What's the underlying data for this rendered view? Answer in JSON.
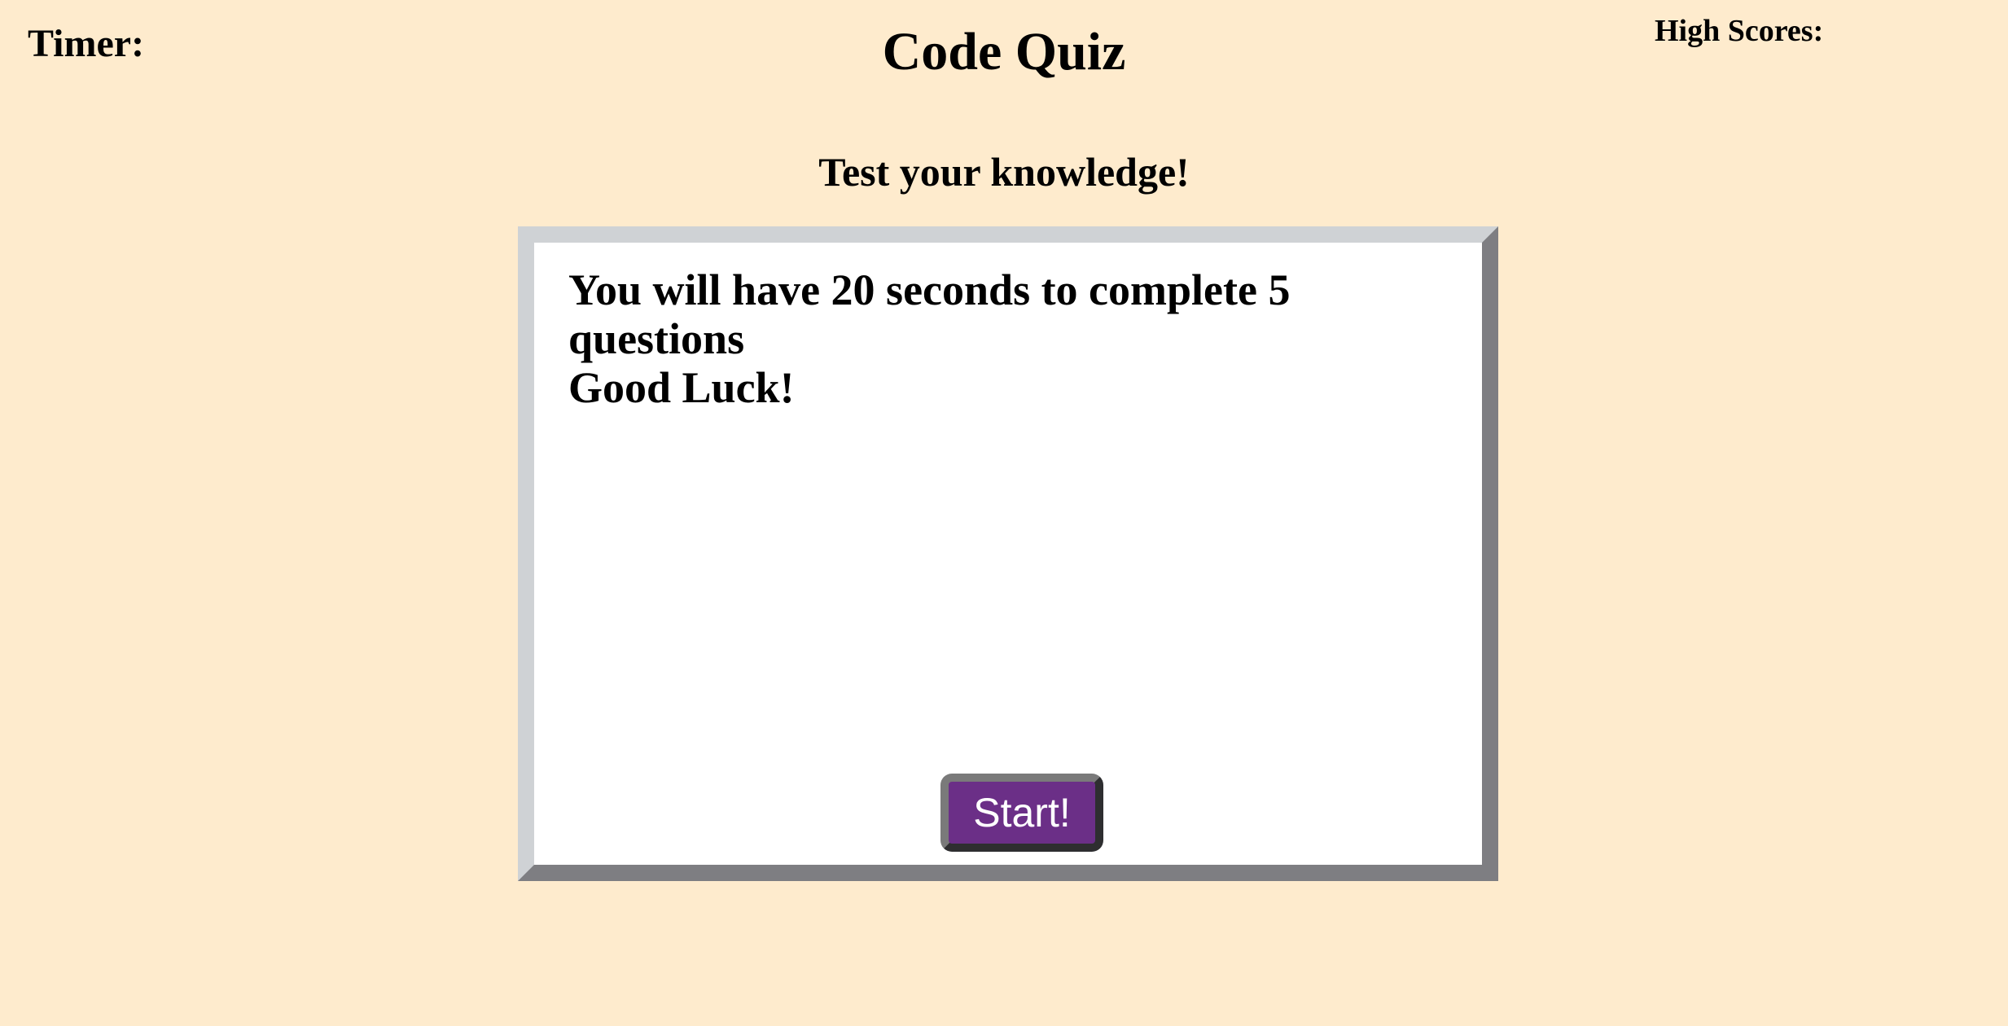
{
  "header": {
    "timer_label": "Timer:",
    "title": "Code Quiz",
    "high_scores_label": "High Scores:"
  },
  "main": {
    "subtitle": "Test your knowledge!",
    "intro_line_1": "You will have 20 seconds to complete 5 questions",
    "intro_line_2": "Good Luck!",
    "start_label": "Start!"
  },
  "colors": {
    "background": "#feebcd",
    "start_button": "#6b2f87",
    "panel": "#ffffff"
  }
}
